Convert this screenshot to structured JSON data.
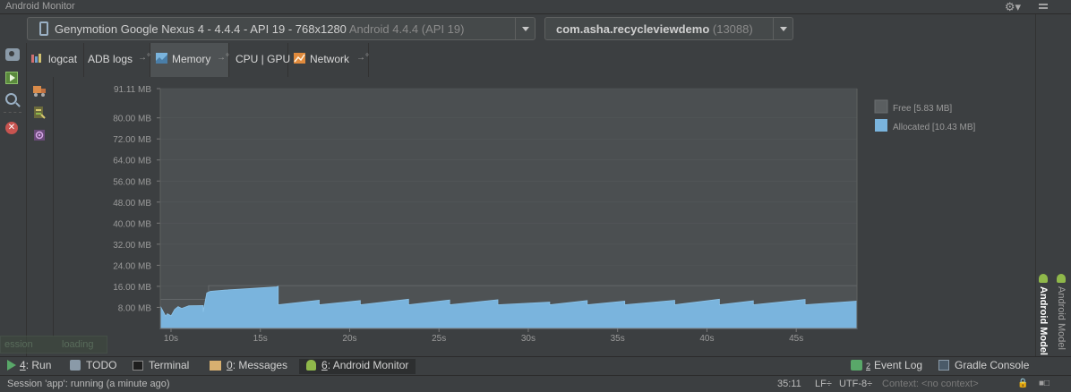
{
  "window": {
    "title": "Android Monitor"
  },
  "device_selector": {
    "device": "Genymotion Google Nexus 4 - 4.4.4 - API 19 - 768x1280",
    "os": "Android 4.4.4 (API 19)"
  },
  "process_selector": {
    "package": "com.asha.recycleviewdemo",
    "pid": "(13088)"
  },
  "tabs": [
    {
      "label": "logcat",
      "icon": "logcat-icon"
    },
    {
      "label": "ADB logs",
      "icon": ""
    },
    {
      "label": "Memory",
      "icon": "memory-icon",
      "selected": true
    },
    {
      "label": "CPU | GPU",
      "icon": ""
    },
    {
      "label": "Network",
      "icon": "network-icon"
    }
  ],
  "legend": {
    "free": "Free [5.83 MB]",
    "allocated": "Allocated [10.43 MB]"
  },
  "colors": {
    "allocated": "#7ab4dd",
    "free": "#4e5254",
    "plot_bg": "#4b4f51",
    "ui_bg": "#3c3f41"
  },
  "chart_data": {
    "type": "area",
    "ylabel": "",
    "xlabel": "",
    "y_tick_labels": [
      "91.11 MB",
      "80.00 MB",
      "72.00 MB",
      "64.00 MB",
      "56.00 MB",
      "48.00 MB",
      "40.00 MB",
      "32.00 MB",
      "24.00 MB",
      "16.00 MB",
      "8.00 MB"
    ],
    "y_ticks": [
      91.11,
      80,
      72,
      64,
      56,
      48,
      40,
      32,
      24,
      16,
      8
    ],
    "x_tick_labels": [
      "10s",
      "15s",
      "20s",
      "25s",
      "30s",
      "35s",
      "40s",
      "45s"
    ],
    "x_ticks": [
      10,
      15,
      20,
      25,
      30,
      35,
      40,
      45
    ],
    "xlim": [
      9.4,
      48.4
    ],
    "ylim": [
      0,
      91.11
    ],
    "series": [
      {
        "name": "Free [5.83 MB]",
        "x": [
          9.4,
          12.1,
          12.1,
          16.0,
          16.0,
          48.4
        ],
        "y": [
          11.0,
          11.0,
          16.3,
          16.3,
          16.3,
          16.3
        ]
      },
      {
        "name": "Allocated [10.43 MB]",
        "x": [
          9.4,
          9.7,
          9.8,
          10.0,
          10.2,
          10.4,
          10.6,
          11.0,
          11.8,
          11.8,
          12.0,
          12.2,
          13.0,
          14.0,
          15.0,
          15.9,
          16.0,
          16.0,
          18.3,
          18.3,
          20.6,
          20.6,
          23.3,
          23.3,
          25.6,
          25.6,
          28.3,
          28.3,
          31.2,
          31.2,
          33.3,
          33.3,
          35.4,
          35.4,
          38.2,
          38.2,
          40.7,
          40.7,
          42.6,
          42.6,
          45.5,
          45.5,
          48.4
        ],
        "y": [
          8.5,
          4.7,
          5.6,
          4.8,
          7.2,
          8.3,
          7.6,
          8.6,
          8.7,
          6.3,
          13.5,
          14.1,
          14.6,
          15.0,
          15.4,
          15.8,
          16.0,
          9.0,
          10.7,
          9.0,
          10.6,
          9.0,
          11.1,
          9.0,
          10.8,
          9.0,
          10.9,
          9.0,
          10.0,
          9.0,
          10.6,
          9.0,
          10.4,
          9.0,
          10.7,
          9.0,
          11.1,
          9.0,
          10.5,
          9.0,
          11.0,
          9.0,
          10.4
        ]
      }
    ]
  },
  "ghost_overlay": {
    "left": "ession",
    "right": "loading"
  },
  "right_strip": {
    "android_model_1": "Android Model",
    "android_model_2": "Android Model"
  },
  "bottom_tools": {
    "run": {
      "num": "4",
      "label": ": Run"
    },
    "todo": {
      "label": "TODO"
    },
    "terminal": {
      "label": "Terminal"
    },
    "messages": {
      "num": "0",
      "label": ": Messages"
    },
    "monitor": {
      "num": "6",
      "label": ": Android Monitor"
    },
    "eventlog": {
      "num": "2",
      "label": "Event Log"
    },
    "gradle": {
      "label": "Gradle Console"
    }
  },
  "status": {
    "session": "Session 'app': running (a minute ago)",
    "position": "35:11",
    "line_sep": "LF÷",
    "encoding": "UTF-8÷",
    "context": "Context: <no context>"
  }
}
